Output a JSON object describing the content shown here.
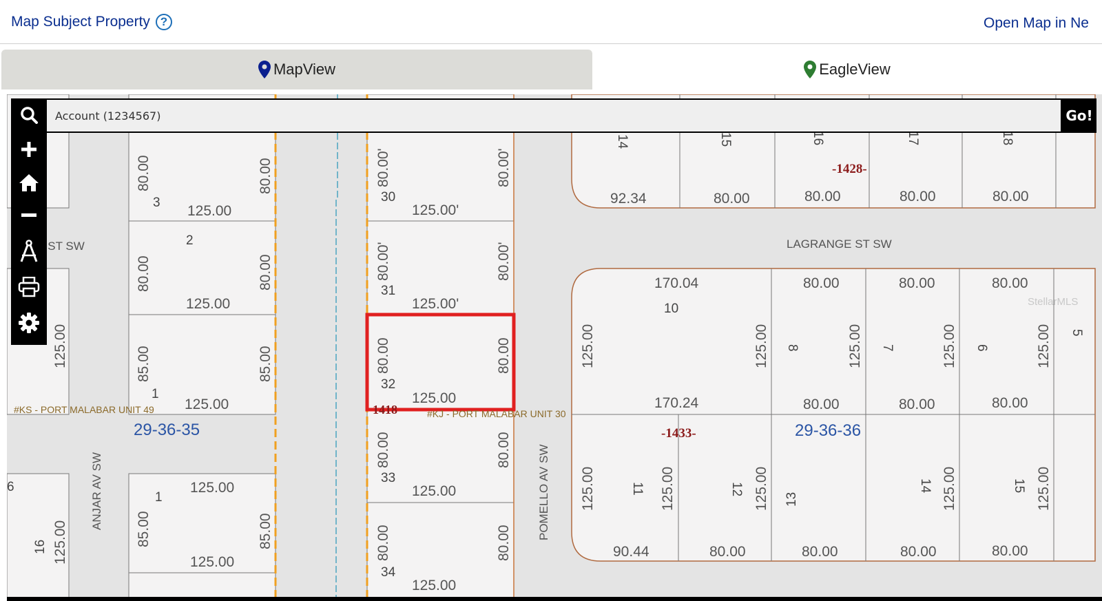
{
  "header": {
    "title": "Map Subject Property",
    "help_symbol": "?",
    "open_map_link": "Open Map in Ne"
  },
  "tabs": [
    {
      "label": "MapView",
      "icon": "map-pin-icon",
      "active": true,
      "color": "#0a1f8f"
    },
    {
      "label": "EagleView",
      "icon": "map-pin-icon",
      "active": false,
      "color": "#2e7d32"
    }
  ],
  "toolbar": {
    "icons": [
      "search-icon",
      "zoom-in-icon",
      "home-icon",
      "zoom-out-icon",
      "measure-icon",
      "print-icon",
      "settings-icon"
    ]
  },
  "search": {
    "value": "Account (1234567)",
    "go_label": "Go!"
  },
  "map": {
    "streets": [
      "ND ST SW",
      "LAGRANGE ST SW",
      "ANJAR AV SW",
      "POMELLO AV SW"
    ],
    "sections": [
      "29-36-35",
      "29-36-36"
    ],
    "blocks": [
      "-1428-",
      "-1433-",
      "1418"
    ],
    "subdivisions": [
      "#KS - PORT MALABAR UNIT 49",
      "#KJ - PORT MALABAR UNIT 30"
    ],
    "lots": {
      "l30": "30",
      "l31": "31",
      "l32": "32",
      "l33": "33",
      "l34": "34",
      "l3": "3",
      "l2": "2",
      "l1": "1",
      "l1b": "1",
      "l16": "16",
      "l6": "6",
      "l10": "10",
      "l8": "8",
      "l7": "7",
      "l6r": "6",
      "l5": "5",
      "l11": "11",
      "l12": "12",
      "l13": "13",
      "l14": "14",
      "l15": "15",
      "t14": "14",
      "t15": "15",
      "t16": "16",
      "t17": "17",
      "t18": "18"
    },
    "dims": {
      "d80q": "80.00'",
      "d125q": "125.00'",
      "d80": "80.00",
      "d85": "85.00",
      "d125": "125.00",
      "d9234": "92.34",
      "d17004": "170.04",
      "d17024": "170.24",
      "d9044": "90.44",
      "d125t": "125"
    },
    "subject_outline_color": "#e02020",
    "watermark": "StellarMLS"
  }
}
